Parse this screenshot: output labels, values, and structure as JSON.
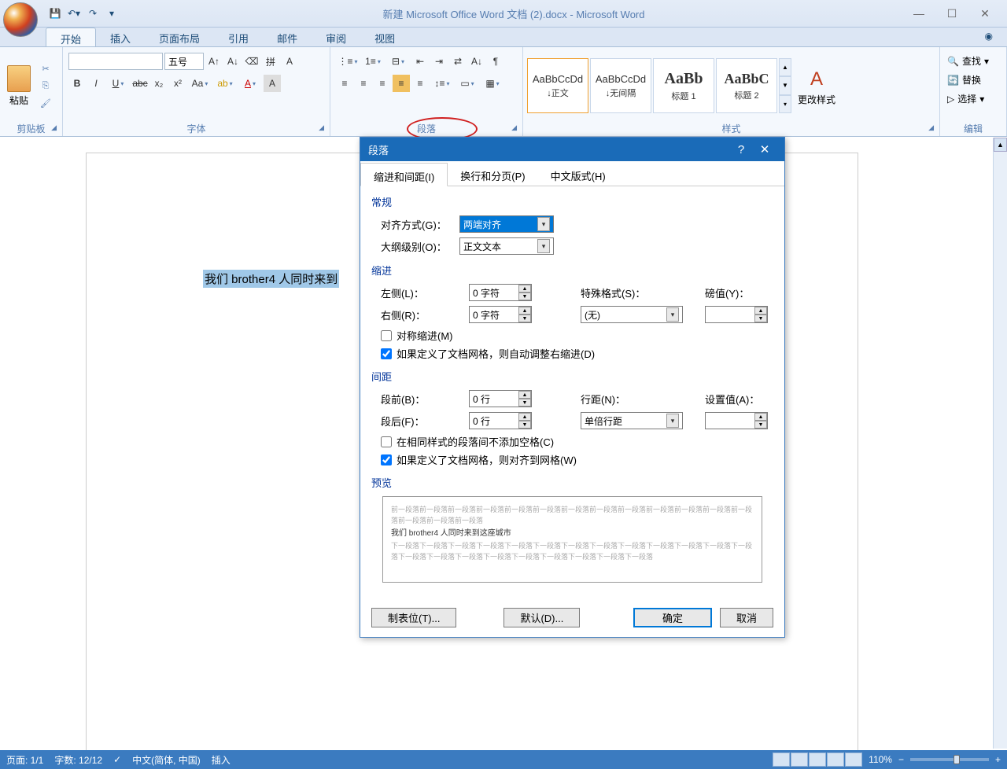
{
  "title": "新建 Microsoft Office Word 文档 (2).docx - Microsoft Word",
  "tabs": {
    "home": "开始",
    "insert": "插入",
    "layout": "页面布局",
    "ref": "引用",
    "mail": "邮件",
    "review": "审阅",
    "view": "视图"
  },
  "ribbon": {
    "clipboard": {
      "label": "剪贴板",
      "paste": "粘贴"
    },
    "font": {
      "label": "字体",
      "size": "五号"
    },
    "paragraph": {
      "label": "段落"
    },
    "styles": {
      "label": "样式",
      "items": [
        {
          "preview": "AaBbCcDd",
          "name": "↓正文"
        },
        {
          "preview": "AaBbCcDd",
          "name": "↓无间隔"
        },
        {
          "preview": "AaBb",
          "name": "标题 1"
        },
        {
          "preview": "AaBbC",
          "name": "标题 2"
        }
      ],
      "change": "更改样式"
    },
    "editing": {
      "label": "编辑",
      "find": "查找",
      "replace": "替换",
      "select": "选择"
    }
  },
  "document_text": "我们 brother4 人同时来到",
  "dialog": {
    "title": "段落",
    "tabs": {
      "indent": "缩进和间距(I)",
      "page": "换行和分页(P)",
      "cn": "中文版式(H)"
    },
    "general": {
      "header": "常规",
      "align_label": "对齐方式(G)：",
      "align_value": "两端对齐",
      "outline_label": "大纲级别(O)：",
      "outline_value": "正文文本"
    },
    "indent": {
      "header": "缩进",
      "left_label": "左侧(L)：",
      "left_value": "0 字符",
      "right_label": "右侧(R)：",
      "right_value": "0 字符",
      "special_label": "特殊格式(S)：",
      "special_value": "(无)",
      "by_label": "磅值(Y)：",
      "mirror": "对称缩进(M)",
      "auto_adjust": "如果定义了文档网格，则自动调整右缩进(D)"
    },
    "spacing": {
      "header": "间距",
      "before_label": "段前(B)：",
      "before_value": "0 行",
      "after_label": "段后(F)：",
      "after_value": "0 行",
      "line_label": "行距(N)：",
      "line_value": "单倍行距",
      "at_label": "设置值(A)：",
      "no_space_same": "在相同样式的段落间不添加空格(C)",
      "snap_grid": "如果定义了文档网格，则对齐到网格(W)"
    },
    "preview": {
      "header": "预览",
      "content": "我们 brother4 人同时来到这座城市",
      "filler1": "前一段落前一段落前一段落前一段落前一段落前一段落前一段落前一段落前一段落前一段落前一段落前一段落前一段落前一段落前一段落前一段落",
      "filler2": "下一段落下一段落下一段落下一段落下一段落下一段落下一段落下一段落下一段落下一段落下一段落下一段落下一段落下一段落下一段落下一段落下一段落下一段落下一段落下一段落下一段落下一段落"
    },
    "buttons": {
      "tabs": "制表位(T)...",
      "default": "默认(D)...",
      "ok": "确定",
      "cancel": "取消"
    }
  },
  "status": {
    "page": "页面: 1/1",
    "words": "字数: 12/12",
    "lang": "中文(简体, 中国)",
    "mode": "插入",
    "zoom": "110%"
  },
  "icons": {
    "find": "🔍",
    "replace": "🔄",
    "select": "▷"
  }
}
